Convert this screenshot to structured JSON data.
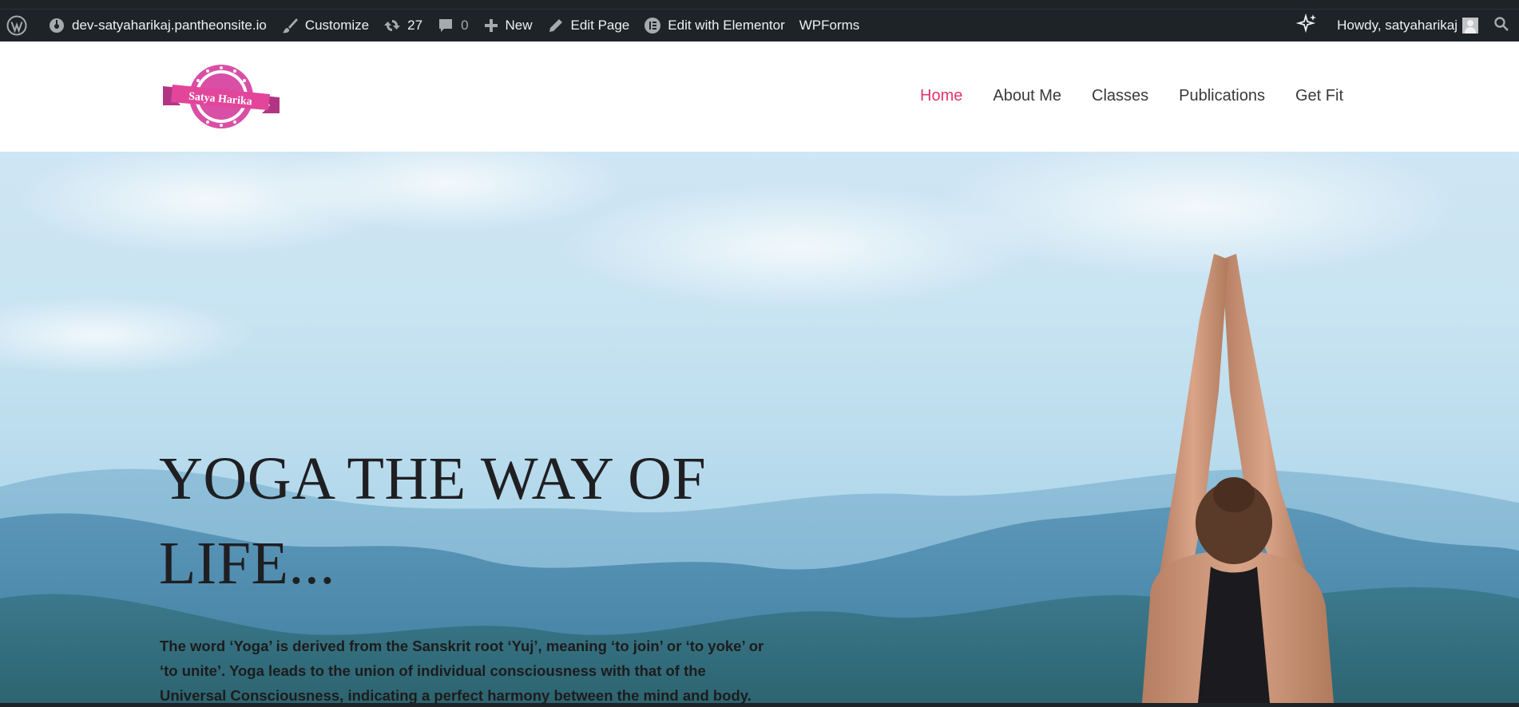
{
  "adminbar": {
    "site": "dev-satyaharikaj.pantheonsite.io",
    "customize": "Customize",
    "updates_count": "27",
    "comments_count": "0",
    "new": "New",
    "edit_page": "Edit Page",
    "edit_elementor": "Edit with Elementor",
    "wpforms": "WPForms",
    "howdy": "Howdy, satyaharikaj"
  },
  "header": {
    "logo_text": "Satya Harika",
    "nav": [
      {
        "label": "Home",
        "active": true
      },
      {
        "label": "About Me",
        "active": false
      },
      {
        "label": "Classes",
        "active": false
      },
      {
        "label": "Publications",
        "active": false
      },
      {
        "label": "Get Fit",
        "active": false
      }
    ]
  },
  "hero": {
    "title": "YOGA THE WAY OF LIFE...",
    "body": "The word ‘Yoga’ is derived from the Sanskrit root ‘Yuj’, meaning ‘to join’ or ‘to yoke’ or ‘to unite’. Yoga leads to the union of individual consciousness with that of the Universal Consciousness, indicating a perfect harmony between the mind and body."
  },
  "colors": {
    "adminbar_bg": "#1d2327",
    "accent_pink": "#e8336b",
    "logo_pink": "#d94fa6"
  }
}
